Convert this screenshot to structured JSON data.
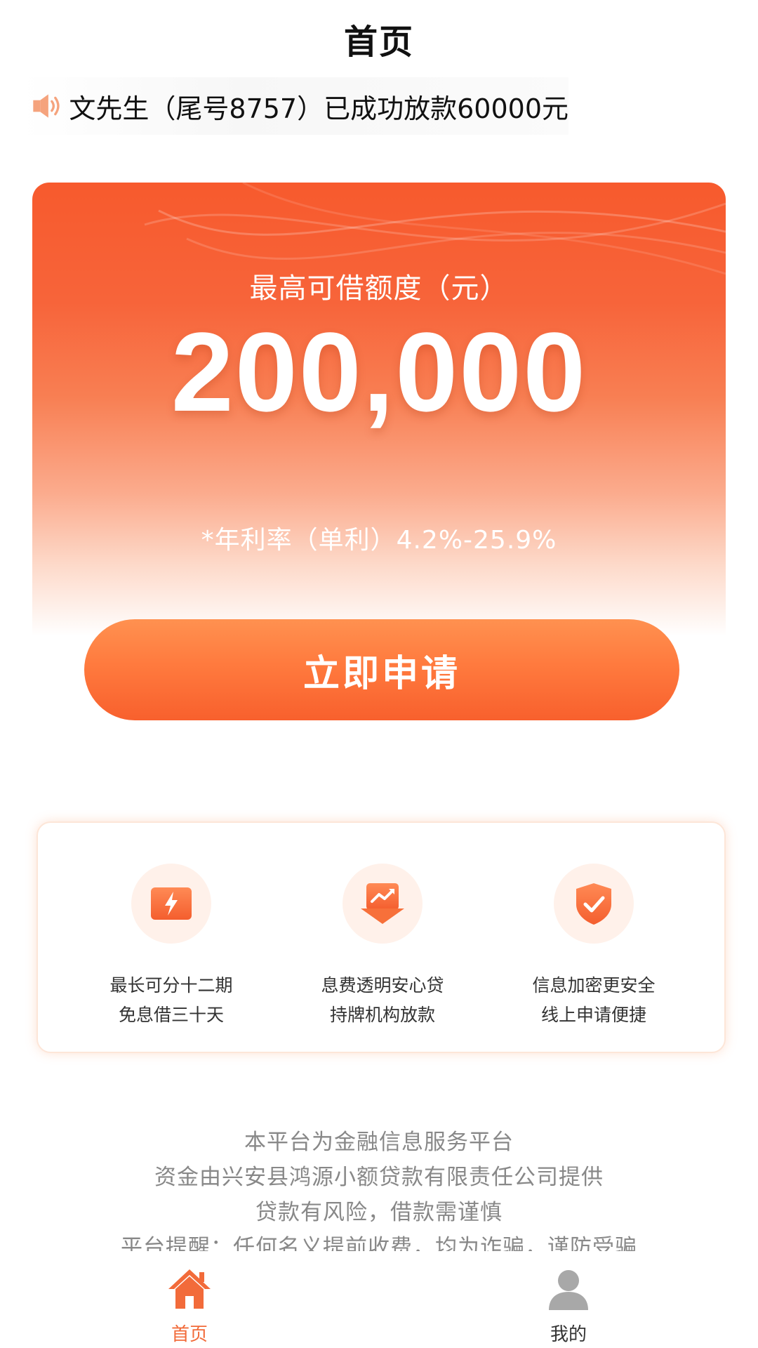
{
  "header": {
    "title": "首页"
  },
  "notice": {
    "icon": "speaker-icon",
    "text": "文先生（尾号8757）已成功放款60000元"
  },
  "hero": {
    "limit_label": "最高可借额度（元）",
    "amount": "200,000",
    "rate": "*年利率（单利）4.2%-25.9%",
    "colors": {
      "top": "#f75a2d",
      "bottom": "#ffffff"
    }
  },
  "apply_button": {
    "label": "立即申请",
    "color": "#f8602d"
  },
  "features": [
    {
      "icon": "lightning-card-icon",
      "line1": "最长可分十二期",
      "line2": "免息借三十天"
    },
    {
      "icon": "trend-down-arrow-icon",
      "line1": "息费透明安心贷",
      "line2": "持牌机构放款"
    },
    {
      "icon": "shield-check-icon",
      "line1": "信息加密更安全",
      "line2": "线上申请便捷"
    }
  ],
  "disclaimer": {
    "lines": [
      "本平台为金融信息服务平台",
      "资金由兴安县鸿源小额贷款有限责任公司提供",
      "贷款有风险，借款需谨慎",
      "平台提醒：任何名义提前收费，均为诈骗，谨防受骗"
    ]
  },
  "tabbar": {
    "tabs": [
      {
        "label": "首页",
        "icon": "home-icon",
        "active": true
      },
      {
        "label": "我的",
        "icon": "user-icon",
        "active": false
      }
    ],
    "active_color": "#f26b3a"
  }
}
